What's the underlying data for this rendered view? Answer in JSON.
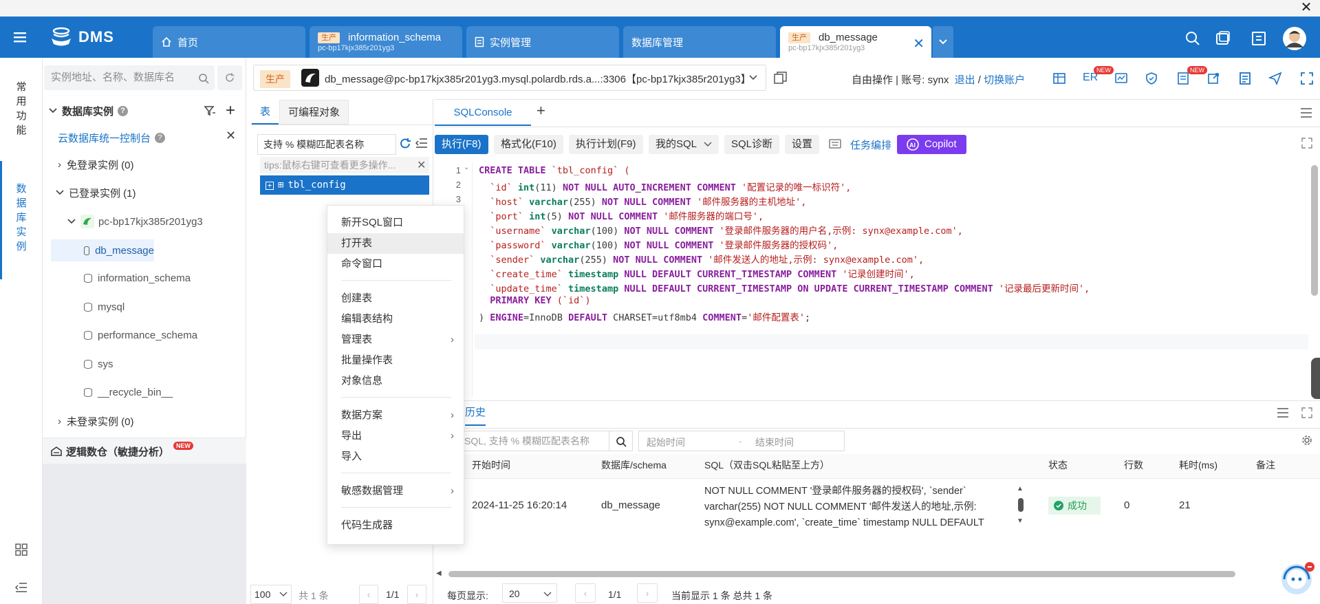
{
  "window": {
    "close": "✕"
  },
  "brand": {
    "name": "DMS"
  },
  "tabs": [
    {
      "label": "首页"
    },
    {
      "env": "生产",
      "label": "information_schema",
      "sub": "pc-bp17kjx385r201yg3"
    },
    {
      "label": "实例管理"
    },
    {
      "label": "数据库管理"
    },
    {
      "env": "生产",
      "label": "db_message",
      "sub": "pc-bp17kjx385r201yg3"
    }
  ],
  "rail": {
    "common": "常用功能",
    "instances": "数据库实例"
  },
  "tree": {
    "search_placeholder": "实例地址、名称、数据库名",
    "header": "数据库实例",
    "console": "云数据库统一控制台",
    "free_login": "免登录实例 (0)",
    "logged": "已登录实例 (1)",
    "instance": "pc-bp17kjx385r201yg3",
    "dbs": [
      "db_message",
      "information_schema",
      "mysql",
      "performance_schema",
      "sys",
      "__recycle_bin__"
    ],
    "not_logged": "未登录实例 (0)",
    "warehouse": "逻辑数仓（敏捷分析）",
    "new_badge": "NEW"
  },
  "conn": {
    "env": "生产",
    "text": "db_message@pc-bp17kjx385r201yg3.mysql.polardb.rds.a...:3306【pc-bp17kjx385r201yg3】",
    "mode": "自由操作 | 账号: synx",
    "logout": "退出",
    "slash": "/",
    "switch": "切换账户",
    "er": "ER",
    "new": "NEW"
  },
  "tblpanel": {
    "tab_table": "表",
    "tab_prog": "可编程对象",
    "search": "支持 % 模糊匹配表名称",
    "tips": "tips:鼠标右键可查看更多操作...",
    "table": "tbl_config",
    "pagesize": "100",
    "total": "共 1 条",
    "page": "1/1"
  },
  "context_menu": {
    "g1": [
      "新开SQL窗口",
      "打开表",
      "命令窗口"
    ],
    "g2": [
      "创建表",
      "编辑表结构",
      "管理表",
      "批量操作表",
      "对象信息"
    ],
    "g3": [
      "数据方案",
      "导出",
      "导入"
    ],
    "g4": [
      "敏感数据管理"
    ],
    "g5": [
      "代码生成器"
    ]
  },
  "editor": {
    "tab": "SQLConsole",
    "add": "+",
    "toolbar": {
      "run": "执行(F8)",
      "format": "格式化(F10)",
      "plan": "执行计划(F9)",
      "mysql": "我的SQL",
      "diag": "SQL诊断",
      "settings": "设置",
      "orchestrate": "任务编排",
      "copilot": "Copilot"
    },
    "line_numbers": [
      "1",
      "2",
      "3"
    ]
  },
  "sql": {
    "l1a": "CREATE TABLE",
    "l1b": " `tbl_config` (",
    "l2a": "  `id` ",
    "l2b": "int",
    "l2c": "(11) ",
    "l2d": "NOT NULL AUTO_INCREMENT COMMENT",
    "l2e": " '配置记录的唯一标识符',",
    "l3a": "  `host` ",
    "l3b": "varchar",
    "l3c": "(255) ",
    "l3d": "NOT NULL COMMENT",
    "l3e": " '邮件服务器的主机地址',",
    "l4a": "  `port` ",
    "l4b": "int",
    "l4c": "(5) ",
    "l4d": "NOT NULL COMMENT",
    "l4e": " '邮件服务器的端口号',",
    "l5a": "  `username` ",
    "l5b": "varchar",
    "l5c": "(100) ",
    "l5d": "NOT NULL COMMENT",
    "l5e": " '登录邮件服务器的用户名,示例: synx@example.com',",
    "l6a": "  `password` ",
    "l6b": "varchar",
    "l6c": "(100) ",
    "l6d": "NOT NULL COMMENT",
    "l6e": " '登录邮件服务器的授权码',",
    "l7a": "  `sender` ",
    "l7b": "varchar",
    "l7c": "(255) ",
    "l7d": "NOT NULL COMMENT",
    "l7e": " '邮件发送人的地址,示例: synx@example.com',",
    "l8a": "  `create_time` ",
    "l8b": "timestamp",
    "l8c": " ",
    "l8d": "NULL DEFAULT CURRENT_TIMESTAMP COMMENT",
    "l8e": " '记录创建时间',",
    "l9a": "  `update_time` ",
    "l9b": "timestamp",
    "l9c": " ",
    "l9d": "NULL DEFAULT CURRENT_TIMESTAMP ON UPDATE CURRENT_TIMESTAMP COMMENT",
    "l9e": " '记录最后更新时间',",
    "l10a": "  PRIMARY KEY",
    "l10b": " (`id`)",
    "l11a": ") ",
    "l11b": "ENGINE",
    "l11c": "=InnoDB ",
    "l11d": "DEFAULT",
    "l11e": " CHARSET=utf8mb4 ",
    "l11f": "COMMENT",
    "l11g": "=",
    "l11h": "'邮件配置表'",
    "l11i": ";"
  },
  "history": {
    "tab": "历史",
    "search": "SQL, 支持 % 模糊匹配表名称",
    "start_ph": "起始时间",
    "range_sep": "-",
    "end_ph": "结束时间",
    "cols": [
      "开始时间",
      "数据库/schema",
      "SQL（双击SQL粘贴至上方）",
      "状态",
      "行数",
      "耗时(ms)",
      "备注"
    ],
    "row": {
      "time": "2024-11-25 16:20:14",
      "db": "db_message",
      "sql1": "NOT NULL COMMENT '登录邮件服务器的授权码', `sender`",
      "sql2": "varchar(255) NOT NULL COMMENT '邮件发送人的地址,示例:",
      "sql3": "synx@example.com', `create_time` timestamp NULL DEFAULT",
      "status": "成功",
      "rows": "0",
      "ms": "21"
    },
    "pager": {
      "label": "每页显示:",
      "size": "20",
      "page": "1/1",
      "summary": "当前显示 1 条 总共 1 条"
    }
  },
  "colors": {
    "primary": "#1a73c8",
    "success": "#21a366",
    "copilot": "#7b3cf0",
    "badge": "#e53935"
  }
}
